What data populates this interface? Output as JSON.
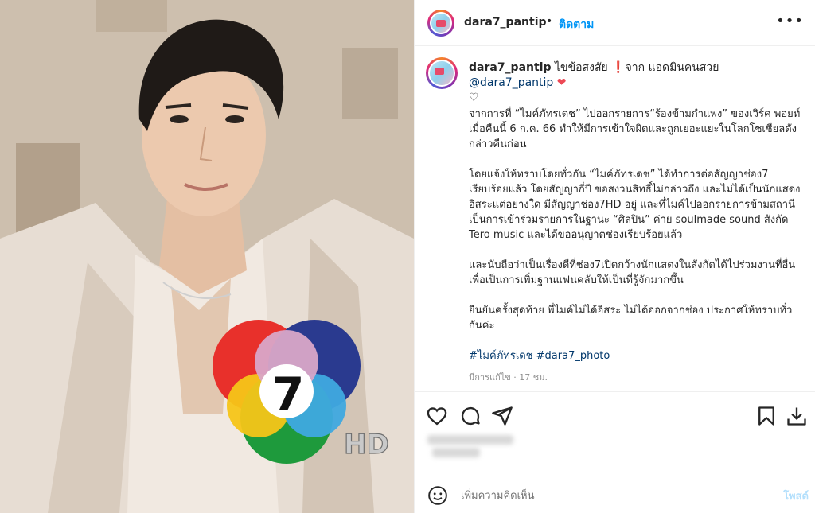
{
  "post": {
    "username": "dara7_pantip",
    "dot": "•",
    "follow_label": "ติดตาม",
    "more_icon": "more-horizontal-icon",
    "caption": {
      "username": "dara7_pantip",
      "intro": "ไขข้อสงสัย",
      "exclaim_emoji": "❗",
      "intro_rest": "จาก แอดมินคนสวย",
      "mention": "@dara7_pantip",
      "heart_red": "❤",
      "heart_outline": "♡",
      "paragraphs": [
        "จากการที่ “ไมค์ภัทรเดช” ไปออกรายการ“ร้องข้ามกำแพง” ของเวิร์ค พอยท์ เมื่อคืนนี้ 6 ก.ค. 66 ทำให้มีการเข้าใจผิดและถูกเยอะแยะในโลกโซเชียลดังกล่าวคืนก่อน",
        "โดยแจ้งให้ทราบโดยทั่วกัน “ไมค์ภัทรเดช” ได้ทำการต่อสัญญาช่อง7 เรียบร้อยแล้ว โดยสัญญากี่ปี ขอสงวนสิทธิ์ไม่กล่าวถึง และไม่ได้เป็นนักแสดงอิสระแต่อย่างใด มีสัญญาช่อง7HD อยู่ และที่ไมค์ไปออกรายการข้ามสถานี เป็นการเข้าร่วมรายการในฐานะ “ศิลปิน” ค่าย soulmade sound สังกัด Tero music และได้ขออนุญาตช่องเรียบร้อยแล้ว",
        "และนับถือว่าเป็นเรื่องดีที่ช่อง7เปิดกว้างนักแสดงในสังกัดได้ไปร่วมงานที่อื่นเพื่อเป็นการเพิ่มฐานแฟนคลับให้เป็นที่รู้จักมากขึ้น",
        "ยืนยันครั้งสุดท้าย พี่ไมค์ไม่ได้อิสระ ไม่ได้ออกจากช่อง ประกาศให้ทราบทั่วกันค่ะ"
      ],
      "hashtags": "#ไมค์ภัทรเดช #dara7_photo",
      "edited": "มีการแก้ไข · 17 ชม."
    },
    "actions": {
      "like_icon": "heart-icon",
      "comment_icon": "comment-icon",
      "share_icon": "send-icon",
      "save_icon": "bookmark-icon",
      "download_icon": "download-icon"
    },
    "comment": {
      "placeholder": "เพิ่มความคิดเห็น",
      "post_label": "โพสต์",
      "emoji_icon": "emoji-icon"
    }
  },
  "photo": {
    "logo_number": "7",
    "logo_suffix": "HD"
  },
  "colors": {
    "follow": "#0095f6",
    "mention": "#00376b",
    "post_disabled": "#b2dffc",
    "muted": "#8e8e8e"
  }
}
